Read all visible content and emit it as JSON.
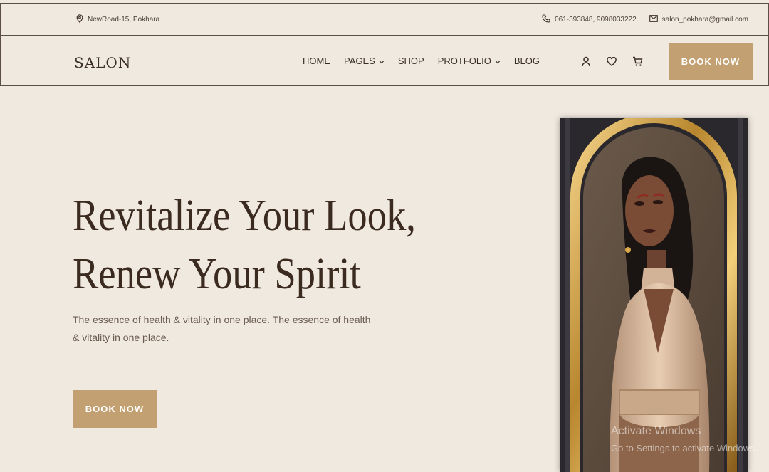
{
  "topbar": {
    "address": "NewRoad-15, Pokhara",
    "phone": "061-393848, 9098033222",
    "email": "salon_pokhara@gmail.com"
  },
  "nav": {
    "logo": "SALON",
    "items": [
      {
        "label": "HOME",
        "dropdown": false
      },
      {
        "label": "PAGES",
        "dropdown": true
      },
      {
        "label": "SHOP",
        "dropdown": false
      },
      {
        "label": "PROTFOLIO",
        "dropdown": true
      },
      {
        "label": "BLOG",
        "dropdown": false
      }
    ],
    "icons": [
      "user-icon",
      "heart-icon",
      "cart-icon"
    ],
    "book_label": "BOOK NOW"
  },
  "hero": {
    "title_line1": "Revitalize Your Look,",
    "title_line2": "Renew Your Spirit",
    "subtitle": "The essence of health & vitality in one place. The essence of health & vitality in one place.",
    "book_label": "BOOK NOW"
  },
  "watermark": {
    "line1": "Activate Windows",
    "line2": "Go to Settings to activate Windows."
  },
  "colors": {
    "background": "#f0e9df",
    "accent": "#c3a071",
    "text": "#3b2a1f"
  }
}
